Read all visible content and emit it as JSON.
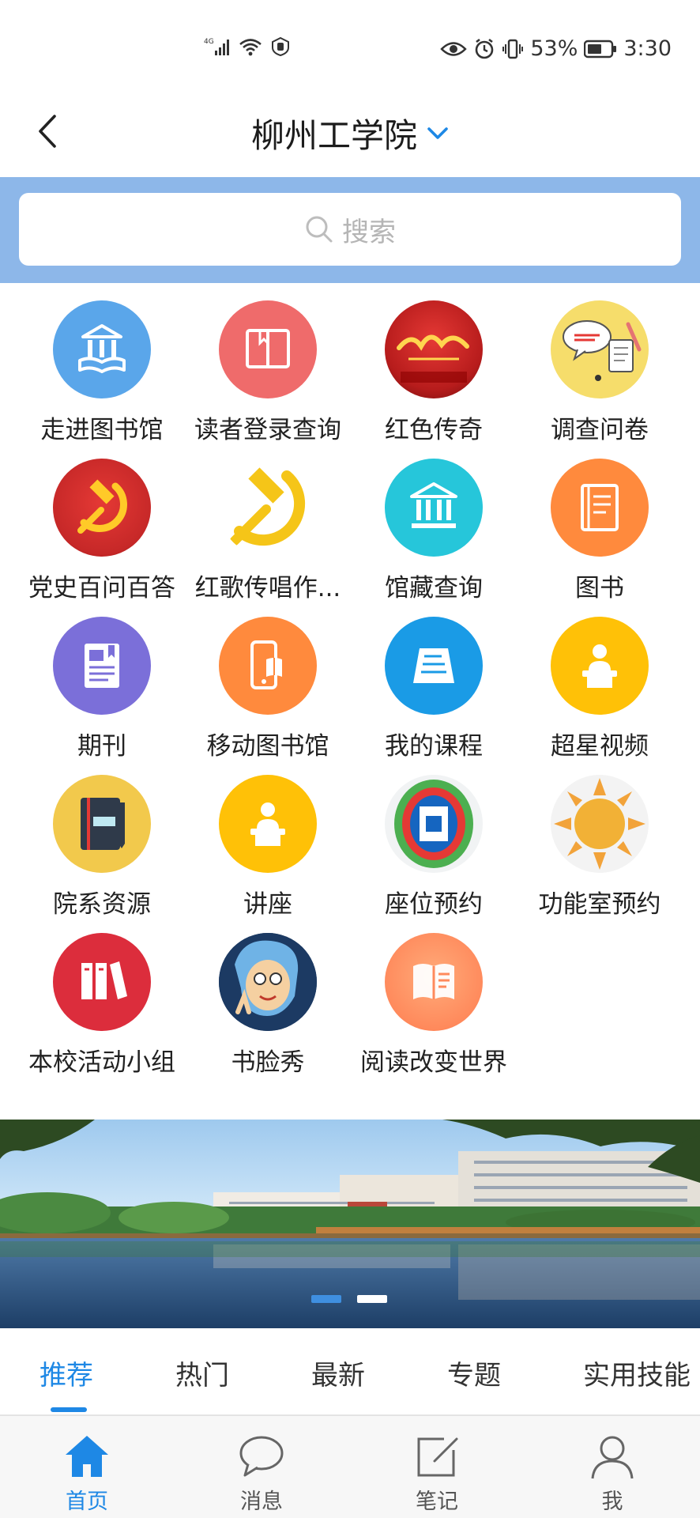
{
  "status_bar": {
    "network": "4G",
    "battery": "53%",
    "time": "3:30"
  },
  "header": {
    "title": "柳州工学院"
  },
  "search": {
    "placeholder": "搜索"
  },
  "grid": {
    "items": [
      {
        "label": "走进图书馆",
        "icon": "library-building-icon"
      },
      {
        "label": "读者登录查询",
        "icon": "open-book-icon"
      },
      {
        "label": "红色传奇",
        "icon": "red-legend-image"
      },
      {
        "label": "调查问卷",
        "icon": "questionnaire-image"
      },
      {
        "label": "党史百问百答",
        "icon": "hammer-sickle-icon"
      },
      {
        "label": "红歌传唱作...",
        "icon": "hammer-sickle-yellow-icon"
      },
      {
        "label": "馆藏查询",
        "icon": "library-building-icon"
      },
      {
        "label": "图书",
        "icon": "book-icon"
      },
      {
        "label": "期刊",
        "icon": "journal-icon"
      },
      {
        "label": "移动图书馆",
        "icon": "mobile-library-icon"
      },
      {
        "label": "我的课程",
        "icon": "course-icon"
      },
      {
        "label": "超星视频",
        "icon": "lecturer-icon"
      },
      {
        "label": "院系资源",
        "icon": "notebook-icon"
      },
      {
        "label": "讲座",
        "icon": "lecturer-icon"
      },
      {
        "label": "座位预约",
        "icon": "seat-map-image"
      },
      {
        "label": "功能室预约",
        "icon": "sun-icon"
      },
      {
        "label": "本校活动小组",
        "icon": "binders-icon"
      },
      {
        "label": "书脸秀",
        "icon": "book-face-image"
      },
      {
        "label": "阅读改变世界",
        "icon": "reading-book-icon"
      }
    ]
  },
  "banner": {
    "slides_total": 2,
    "active_slide": 1
  },
  "tabs": [
    {
      "label": "推荐",
      "active": true
    },
    {
      "label": "热门",
      "active": false
    },
    {
      "label": "最新",
      "active": false
    },
    {
      "label": "专题",
      "active": false
    },
    {
      "label": "实用技能",
      "active": false
    }
  ],
  "bottom_nav": [
    {
      "label": "首页",
      "icon": "home-icon",
      "active": true
    },
    {
      "label": "消息",
      "icon": "message-icon",
      "active": false
    },
    {
      "label": "笔记",
      "icon": "note-icon",
      "active": false
    },
    {
      "label": "我",
      "icon": "user-icon",
      "active": false
    }
  ],
  "colors": {
    "accent": "#1e88e5",
    "search_band": "#8db7e9"
  }
}
